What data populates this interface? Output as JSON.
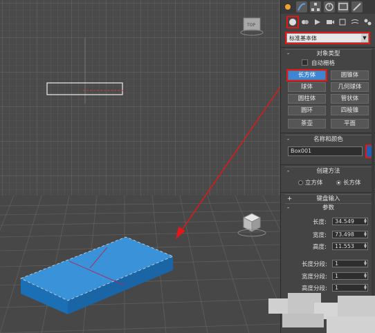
{
  "app": "3ds Max",
  "panel": {
    "category_dropdown": "标准基本体",
    "object_type": {
      "title": "对象类型",
      "autogrid_label": "自动栅格",
      "buttons": [
        "长方体",
        "圆锥体",
        "球体",
        "几何球体",
        "圆柱体",
        "管状体",
        "圆环",
        "四棱锥",
        "茶壶",
        "平面"
      ],
      "active_index": 0
    },
    "name_color": {
      "title": "名称和颜色",
      "name_value": "Box001",
      "color": "#1f5fb5"
    },
    "creation_method": {
      "title": "创建方法",
      "options": [
        "立方体",
        "长方体"
      ],
      "selected_index": 1
    },
    "keyboard_entry": {
      "title": "键盘输入"
    },
    "parameters": {
      "title": "参数",
      "length_label": "长度:",
      "length_value": "34.549",
      "width_label": "宽度:",
      "width_value": "73.498",
      "height_label": "高度:",
      "height_value": "11.553",
      "length_segs_label": "长度分段:",
      "length_segs_value": "1",
      "width_segs_label": "宽度分段:",
      "width_segs_value": "1",
      "height_segs_label": "高度分段:",
      "height_segs_value": "1"
    }
  },
  "colors": {
    "highlight": "#e01818",
    "active_button": "#3d86d6",
    "box": "#1f7fc8"
  },
  "icons": {
    "tabs": [
      "create-tab-icon",
      "modify-tab-icon",
      "hierarchy-tab-icon",
      "motion-tab-icon",
      "display-tab-icon",
      "utilities-tab-icon"
    ],
    "subcategories": [
      "geometry-icon",
      "shapes-icon",
      "lights-icon",
      "cameras-icon",
      "helpers-icon",
      "spacewarps-icon",
      "systems-icon"
    ]
  }
}
